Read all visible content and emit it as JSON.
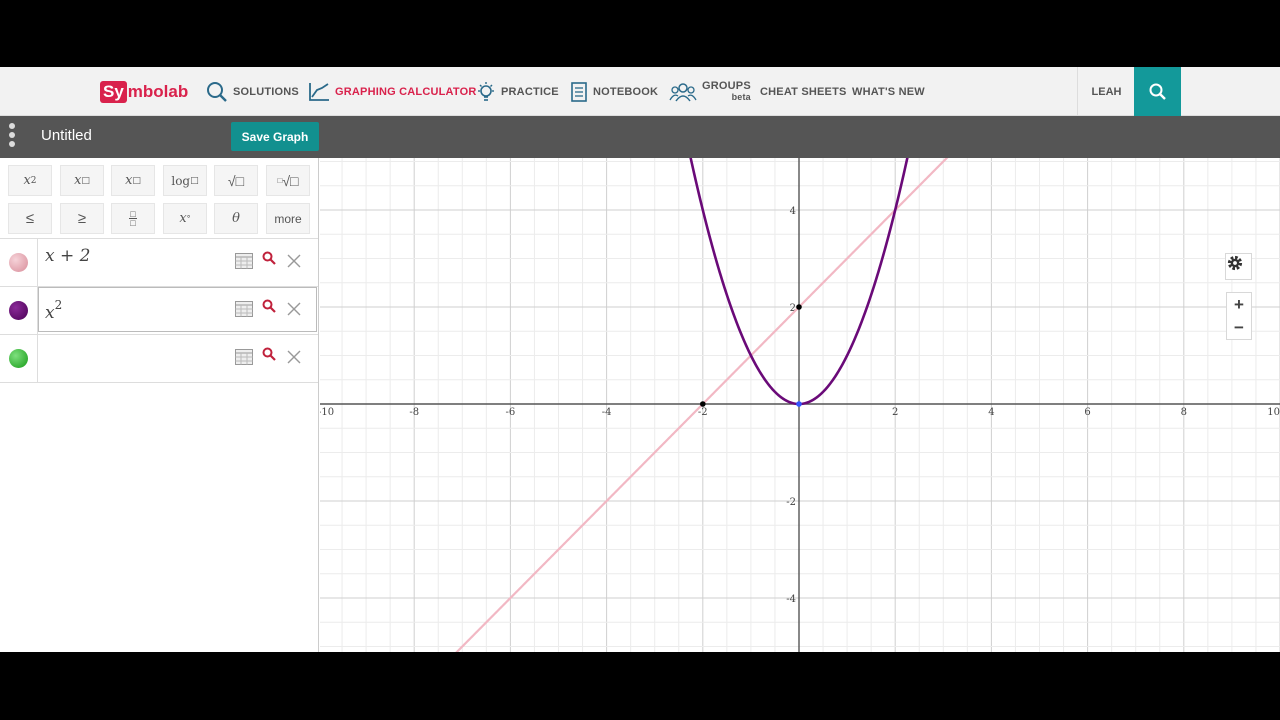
{
  "nav": {
    "logo_sy": "Sy",
    "logo_rest": "mbolab",
    "items": [
      {
        "label": "SOLUTIONS",
        "icon": "search-icon"
      },
      {
        "label": "GRAPHING CALCULATOR",
        "icon": "graph-icon",
        "active": true
      },
      {
        "label": "PRACTICE",
        "icon": "lightbulb-icon"
      },
      {
        "label": "NOTEBOOK",
        "icon": "notebook-icon"
      },
      {
        "label": "GROUPS",
        "sub": "beta",
        "icon": "groups-icon"
      },
      {
        "label": "CHEAT SHEETS"
      },
      {
        "label": "WHAT'S NEW"
      }
    ],
    "user": "LEAH",
    "accent": "#d9224c",
    "teal": "#13999a"
  },
  "graphbar": {
    "title": "Untitled",
    "save_label": "Save Graph"
  },
  "keypad": {
    "row1": [
      "x2",
      "x□",
      "x□",
      "log□",
      "√□",
      "□√□"
    ],
    "row2": [
      "≤",
      "≥",
      "□/□",
      "x°",
      "θ",
      "more"
    ]
  },
  "expressions": [
    {
      "base": "x + 2",
      "sup": "",
      "color": "#e3a3ad"
    },
    {
      "base": "x",
      "sup": "2",
      "color": "#6a0a78"
    },
    {
      "base": "",
      "sup": "",
      "color": "#1fa01f"
    }
  ],
  "chart_data": {
    "type": "line",
    "xlim": [
      -10,
      10
    ],
    "ylim": [
      -5,
      5
    ],
    "x_ticks": [
      "-10",
      "-8",
      "-6",
      "-4",
      "-2",
      "2",
      "4",
      "6",
      "8",
      "10"
    ],
    "y_ticks": [
      "4",
      "2",
      "-2",
      "-4"
    ],
    "grid": true,
    "series": [
      {
        "expression": "x + 2",
        "color": "#f2b8c4"
      },
      {
        "expression": "x^2",
        "color": "#6a0a78"
      }
    ],
    "points": [
      {
        "x": -2,
        "y": 0,
        "color": "#000000"
      },
      {
        "x": 0,
        "y": 2,
        "color": "#000000"
      },
      {
        "x": 0,
        "y": 0,
        "color": "#3355ff"
      }
    ]
  }
}
